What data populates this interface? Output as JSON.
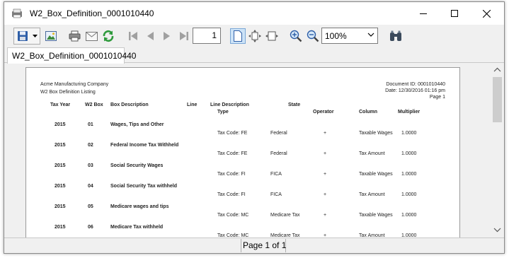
{
  "window": {
    "title": "W2_Box_Definition_0001010440"
  },
  "toolbar": {
    "page_number": "1",
    "zoom": "100%",
    "icons": [
      "save-icon",
      "save-dropdown-icon",
      "export-image-icon",
      "print-icon",
      "email-icon",
      "refresh-icon",
      "first-page-icon",
      "previous-page-icon",
      "next-page-icon",
      "last-page-icon",
      "single-page-icon",
      "fit-page-icon",
      "fit-width-icon",
      "zoom-in-icon",
      "zoom-out-icon",
      "find-icon"
    ]
  },
  "tabs": [
    {
      "label": "W2_Box_Definition_0001010440"
    }
  ],
  "report": {
    "company": "Acme Manufacturing Company",
    "report_title": "W2 Box Definition Listing",
    "document_id": "Document ID: 0001010440",
    "date": "Date: 12/30/2016  01:16 pm",
    "page": "Page 1",
    "headers": {
      "tax_year": "Tax Year",
      "w2_box": "W2 Box",
      "box_description": "Box Description",
      "line": "Line",
      "line_description": "Line Description",
      "state": "State",
      "type": "Type",
      "operator": "Operator",
      "column": "Column",
      "multiplier": "Multiplier"
    },
    "rows": [
      {
        "year": "2015",
        "box": "01",
        "desc": "Wages, Tips and Other",
        "type": "Tax Code: FE",
        "state": "Federal",
        "operator": "+",
        "column": "Taxable Wages",
        "multiplier": "1.0000"
      },
      {
        "year": "2015",
        "box": "02",
        "desc": "Federal Income Tax Withheld",
        "type": "Tax Code: FE",
        "state": "Federal",
        "operator": "+",
        "column": "Tax Amount",
        "multiplier": "1.0000"
      },
      {
        "year": "2015",
        "box": "03",
        "desc": "Social Security Wages",
        "type": "Tax Code: FI",
        "state": "FICA",
        "operator": "+",
        "column": "Taxable Wages",
        "multiplier": "1.0000"
      },
      {
        "year": "2015",
        "box": "04",
        "desc": "Social Security Tax withheld",
        "type": "Tax Code: FI",
        "state": "FICA",
        "operator": "+",
        "column": "Tax Amount",
        "multiplier": "1.0000"
      },
      {
        "year": "2015",
        "box": "05",
        "desc": "Medicare wages and tips",
        "type": "Tax Code: MC",
        "state": "Medicare Tax",
        "operator": "+",
        "column": "Taxable Wages",
        "multiplier": "1.0000"
      },
      {
        "year": "2015",
        "box": "06",
        "desc": "Medicare Tax withheld",
        "type": "Tax Code: MC",
        "state": "Medicare Tax",
        "operator": "+",
        "column": "Tax Amount",
        "multiplier": "1.0000"
      }
    ]
  },
  "status": {
    "page_label": "Page 1 of 1"
  },
  "colors": {
    "accent_green": "#2e9a3c",
    "nav_gray": "#a0a0a0",
    "active_bg": "#cde3f7"
  }
}
